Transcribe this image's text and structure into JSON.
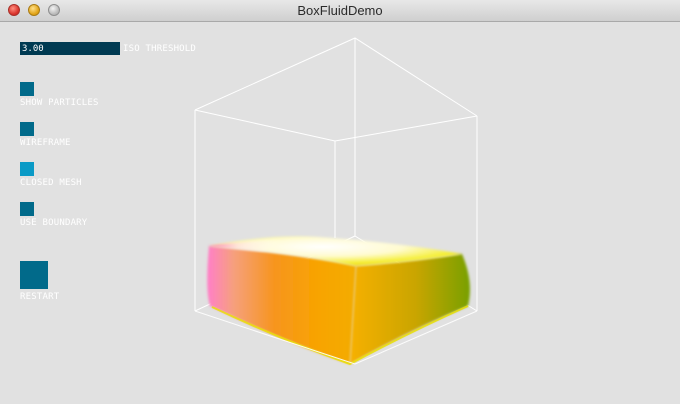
{
  "window": {
    "title": "BoxFluidDemo"
  },
  "controls": {
    "iso_slider": {
      "value": "3.00",
      "label": "ISO THRESHOLD"
    },
    "show_particles": {
      "label": "SHOW PARTICLES",
      "checked": false
    },
    "wireframe": {
      "label": "WIREFRAME",
      "checked": false
    },
    "closed_mesh": {
      "label": "CLOSED MESH",
      "checked": true
    },
    "use_boundary": {
      "label": "USE BOUNDARY",
      "checked": false
    },
    "restart": {
      "label": "RESTART"
    }
  },
  "colors": {
    "background": "#e1e1e1",
    "control_fill": "#016a8a",
    "control_active": "#0a9ac6",
    "slider_bg": "#003a52",
    "wireframe": "#ffffff"
  }
}
